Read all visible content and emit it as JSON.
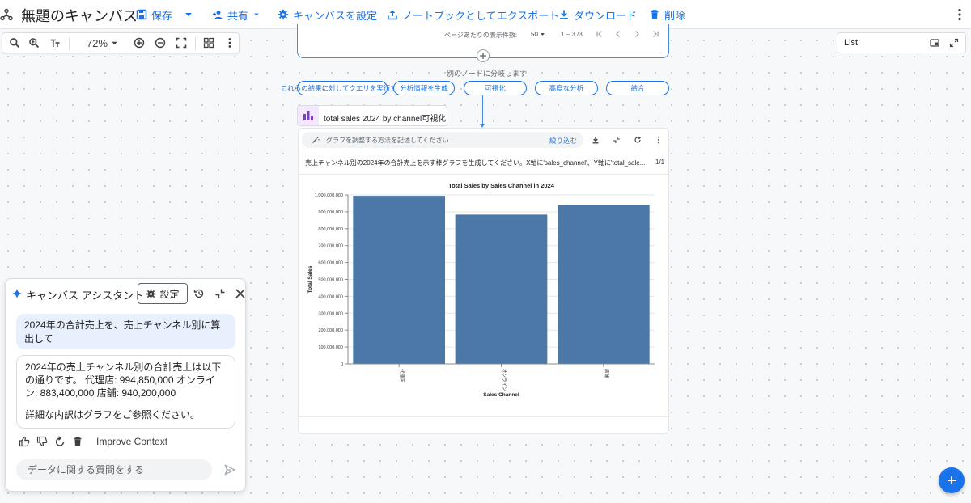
{
  "header": {
    "title": "無題のキャンバス",
    "save_label": "保存",
    "share_label": "共有",
    "canvas_settings_label": "キャンバスを設定",
    "export_notebook_label": "ノートブックとしてエクスポート",
    "download_label": "ダウンロード",
    "delete_label": "削除"
  },
  "zoom": {
    "value": "72%"
  },
  "list_panel": {
    "label": "List"
  },
  "table_node": {
    "rows_per_page_label": "ページあたりの表示件数:",
    "rows_per_page_value": "50",
    "page_range": "1 – 3 /3"
  },
  "branch": {
    "label": "別のノードに分岐します",
    "chips": [
      "これらの結果に対してクエリを実行する",
      "分析情報を生成",
      "可視化",
      "高度な分析",
      "結合"
    ]
  },
  "viz_node": {
    "title": "total sales 2024 by channel可視化",
    "prompt_placeholder": "グラフを調整する方法を記述してください",
    "refine_label": "絞り込む",
    "description": "売上チャンネル別の2024年の合計売上を示す棒グラフを生成してください。X軸に'sales_channel'、Y軸に'total_sale...",
    "page_count": "1/1"
  },
  "chart_data": {
    "type": "bar",
    "title": "Total Sales by Sales Channel in 2024",
    "xlabel": "Sales Channel",
    "ylabel": "Total Sales",
    "categories": [
      "代理店",
      "オンライン",
      "店舗"
    ],
    "values": [
      994850000,
      883400000,
      940200000
    ],
    "ylim": [
      0,
      1000000000
    ],
    "yticks": [
      0,
      100000000,
      200000000,
      300000000,
      400000000,
      500000000,
      600000000,
      700000000,
      800000000,
      900000000,
      1000000000
    ],
    "ytick_labels": [
      "0",
      "100,000,000",
      "200,000,000",
      "300,000,000",
      "400,000,000",
      "500,000,000",
      "600,000,000",
      "700,000,000",
      "800,000,000",
      "900,000,000",
      "1,000,000,000"
    ],
    "grid": true,
    "bar_color": "#4c78a8"
  },
  "assistant": {
    "title": "キャンバス アシスタント",
    "settings_label": "設定",
    "user_message": "2024年の合計売上を、売上チャンネル別に算出して",
    "bot_message_p1": "2024年の売上チャンネル別の合計売上は以下の通りです。 代理店: 994,850,000 オンライン: 883,400,000 店舗: 940,200,000",
    "bot_message_p2": "詳細な内訳はグラフをご参照ください。",
    "improve_context_label": "Improve Context",
    "input_placeholder": "データに関する質問をする"
  },
  "colors": {
    "accent": "#1a73e8",
    "bar": "#4c78a8"
  }
}
